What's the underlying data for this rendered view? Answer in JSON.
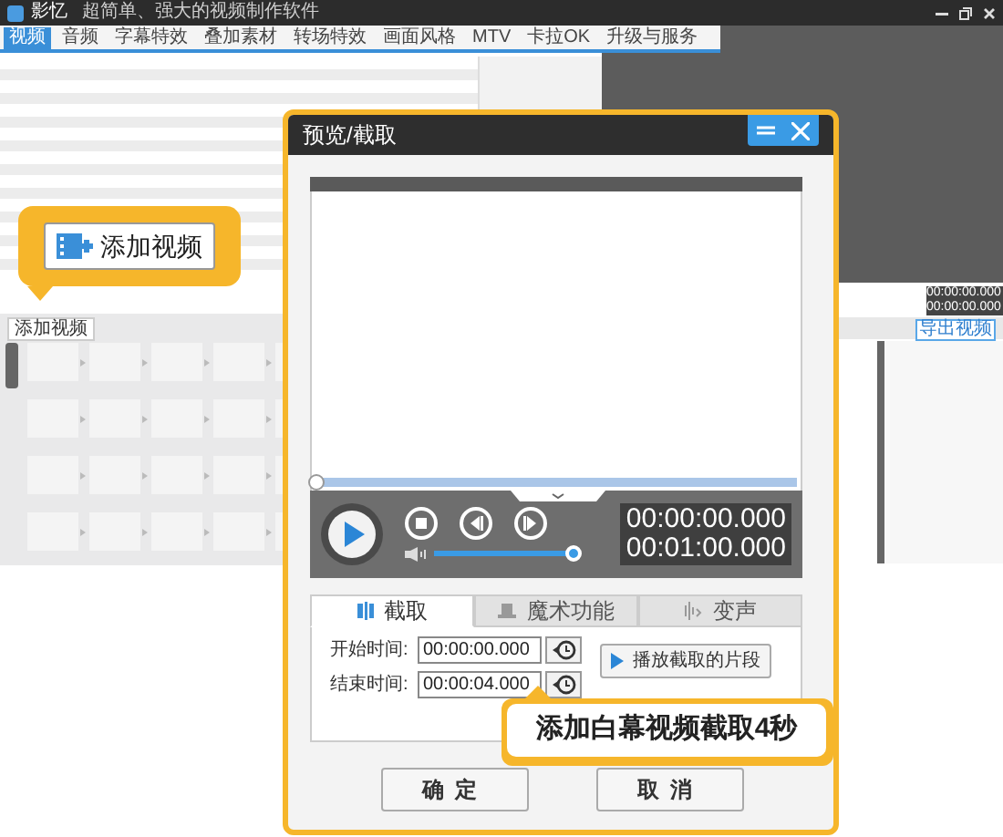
{
  "app": {
    "title": "影忆",
    "subtitle": "超简单、强大的视频制作软件",
    "menu": [
      {
        "label": "视频",
        "selected": true
      },
      {
        "label": "音频",
        "selected": false
      },
      {
        "label": "字幕特效",
        "selected": false
      },
      {
        "label": "叠加素材",
        "selected": false
      },
      {
        "label": "转场特效",
        "selected": false
      },
      {
        "label": "画面风格",
        "selected": false
      },
      {
        "label": "MTV",
        "selected": false
      },
      {
        "label": "卡拉OK",
        "selected": false
      },
      {
        "label": "升级与服务",
        "selected": false
      }
    ],
    "timecodes": [
      "00:00:00.000",
      "00:00:00.000"
    ],
    "export_button": "导出视频",
    "add_video_button": "添加视频"
  },
  "callout_add_video": "添加视频",
  "dialog": {
    "title": "预览/截取",
    "progress": {
      "level": 0
    },
    "volume": {
      "level": 1
    },
    "time_current": "00:00:00.000",
    "time_total": "00:01:00.000",
    "tabs": [
      {
        "label": "截取",
        "selected": true
      },
      {
        "label": "魔术功能",
        "selected": false
      },
      {
        "label": "变声",
        "selected": false
      }
    ],
    "fields": [
      {
        "label": "开始时间:",
        "value": "00:00:00.000"
      },
      {
        "label": "结束时间:",
        "value": "00:00:04.000"
      }
    ],
    "play_clip_button": "播放截取的片段",
    "buttons": [
      "确定",
      "取消"
    ]
  },
  "callout_clip": "添加白幕视频截取4秒"
}
